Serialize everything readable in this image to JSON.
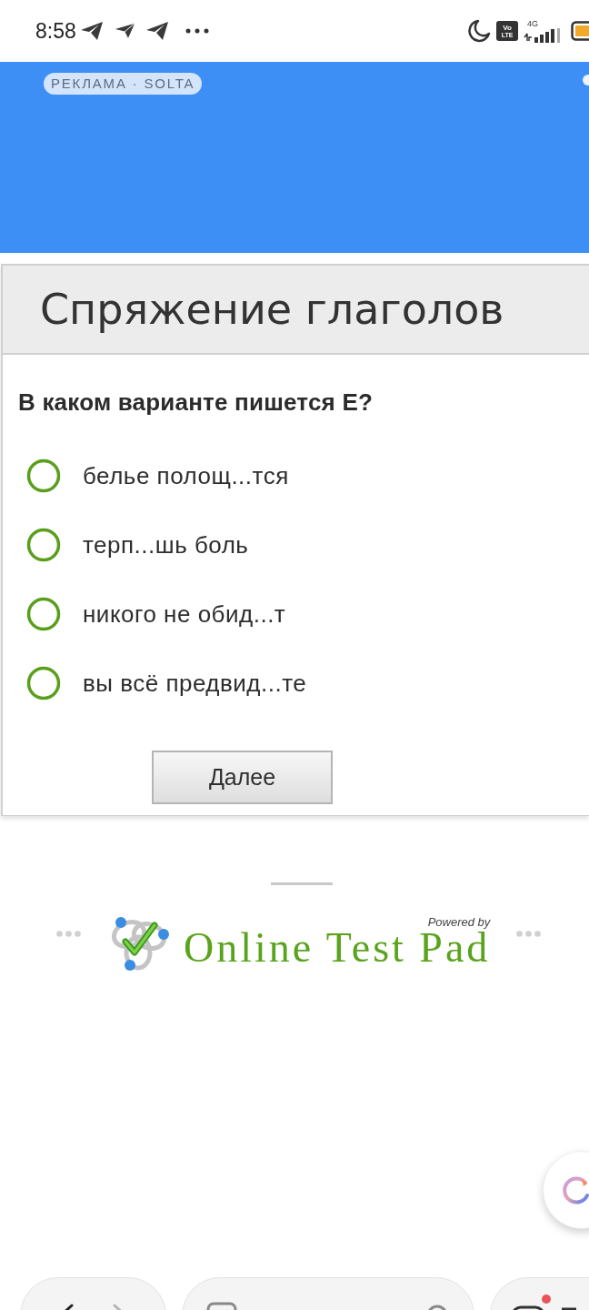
{
  "status_bar": {
    "time": "8:58",
    "network_badge": [
      "Vo",
      "LTE"
    ],
    "network_type": "4G"
  },
  "ad": {
    "badge": "РЕКЛАМА · SOLTA"
  },
  "test": {
    "title": "Спряжение глаголов",
    "question": "В каком варианте пишется Е?",
    "options": [
      {
        "label": "белье полощ...тся",
        "selected": false
      },
      {
        "label": "терп...шь боль",
        "selected": false
      },
      {
        "label": "никого не обид...т",
        "selected": false
      },
      {
        "label": "вы всё предвид...те",
        "selected": false
      }
    ],
    "next_button": "Далее"
  },
  "footer": {
    "powered_by": "Powered by",
    "brand": "Online Test Pad"
  }
}
